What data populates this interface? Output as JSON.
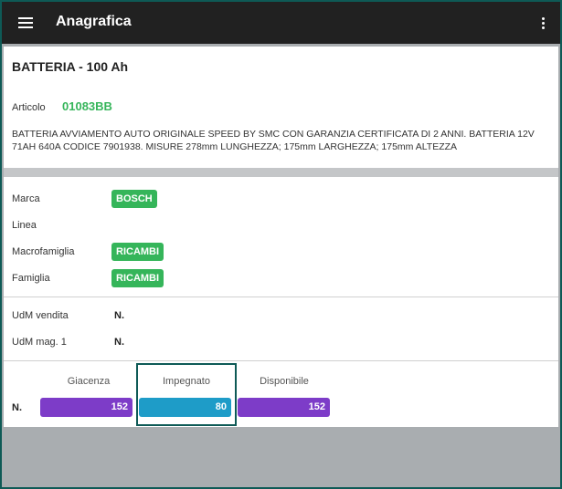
{
  "appbar": {
    "title": "Anagrafica",
    "menu_icon": "hamburger-icon",
    "overflow_icon": "more-vert-icon"
  },
  "product": {
    "name": "BATTERIA - 100 Ah",
    "article_label": "Articolo",
    "article_code": "01083BB",
    "description": "BATTERIA AVVIAMENTO AUTO ORIGINALE SPEED BY SMC CON GARANZIA CERTIFICATA DI 2 ANNI. BATTERIA 12V 71AH 640A CODICE 7901938. MISURE 278mm LUNGHEZZA; 175mm LARGHEZZA; 175mm ALTEZZA"
  },
  "classification": {
    "marca_label": "Marca",
    "marca_value": "BOSCH",
    "linea_label": "Linea",
    "macrofamiglia_label": "Macrofamiglia",
    "macrofamiglia_value": "RICAMBI",
    "famiglia_label": "Famiglia",
    "famiglia_value": "RICAMBI"
  },
  "udm": {
    "vendita_label": "UdM vendita",
    "vendita_value": "N.",
    "mag_label": "UdM mag. 1",
    "mag_value": "N."
  },
  "stock": {
    "unit": "N.",
    "giacenza_label": "Giacenza",
    "giacenza_value": "152",
    "impegnato_label": "Impegnato",
    "impegnato_value": "80",
    "disponibile_label": "Disponibile",
    "disponibile_value": "152"
  },
  "colors": {
    "appbar": "#212121",
    "accent_green": "#35b55a",
    "purple": "#7d3cc8",
    "blue": "#1e9cc8",
    "frame": "#0e5a56"
  }
}
